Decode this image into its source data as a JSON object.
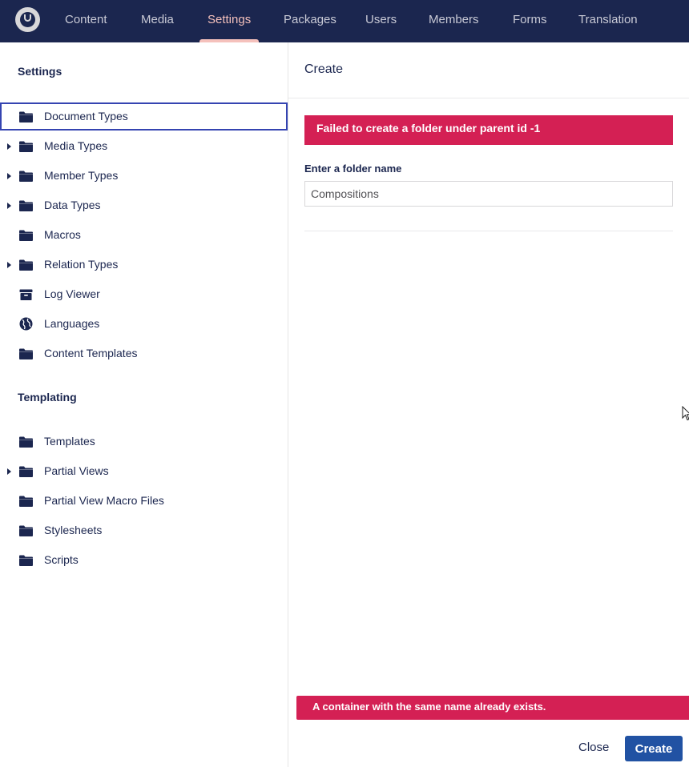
{
  "nav": {
    "logo": "umbraco-logo",
    "items": [
      {
        "label": "Content"
      },
      {
        "label": "Media"
      },
      {
        "label": "Settings",
        "active": true
      },
      {
        "label": "Packages"
      },
      {
        "label": "Users"
      },
      {
        "label": "Members"
      },
      {
        "label": "Forms"
      },
      {
        "label": "Translation"
      }
    ]
  },
  "tree": {
    "settings_title": "Settings",
    "settings_items": [
      {
        "label": "Document Types",
        "icon": "folder-icon",
        "expandable": false,
        "selected": true
      },
      {
        "label": "Media Types",
        "icon": "folder-icon",
        "expandable": true
      },
      {
        "label": "Member Types",
        "icon": "folder-icon",
        "expandable": true
      },
      {
        "label": "Data Types",
        "icon": "folder-icon",
        "expandable": true
      },
      {
        "label": "Macros",
        "icon": "folder-icon",
        "expandable": false
      },
      {
        "label": "Relation Types",
        "icon": "folder-icon",
        "expandable": true
      },
      {
        "label": "Log Viewer",
        "icon": "archive-icon",
        "expandable": false
      },
      {
        "label": "Languages",
        "icon": "globe-icon",
        "expandable": false
      },
      {
        "label": "Content Templates",
        "icon": "folder-icon",
        "expandable": false
      }
    ],
    "templating_title": "Templating",
    "templating_items": [
      {
        "label": "Templates",
        "icon": "folder-icon",
        "expandable": false
      },
      {
        "label": "Partial Views",
        "icon": "folder-icon",
        "expandable": true
      },
      {
        "label": "Partial View Macro Files",
        "icon": "folder-icon",
        "expandable": false
      },
      {
        "label": "Stylesheets",
        "icon": "folder-icon",
        "expandable": false
      },
      {
        "label": "Scripts",
        "icon": "folder-icon",
        "expandable": false
      }
    ]
  },
  "panel": {
    "title": "Create",
    "error_message": "Failed to create a folder under parent id -1",
    "field_label": "Enter a folder name",
    "field_value": "Compositions",
    "bottom_error": "A container with the same name already exists.",
    "close_label": "Close",
    "create_label": "Create"
  },
  "colors": {
    "nav_bg": "#1b264f",
    "accent": "#f5c1bc",
    "error": "#d42054",
    "primary_button": "#2152a3",
    "selected_border": "#3544b1"
  }
}
